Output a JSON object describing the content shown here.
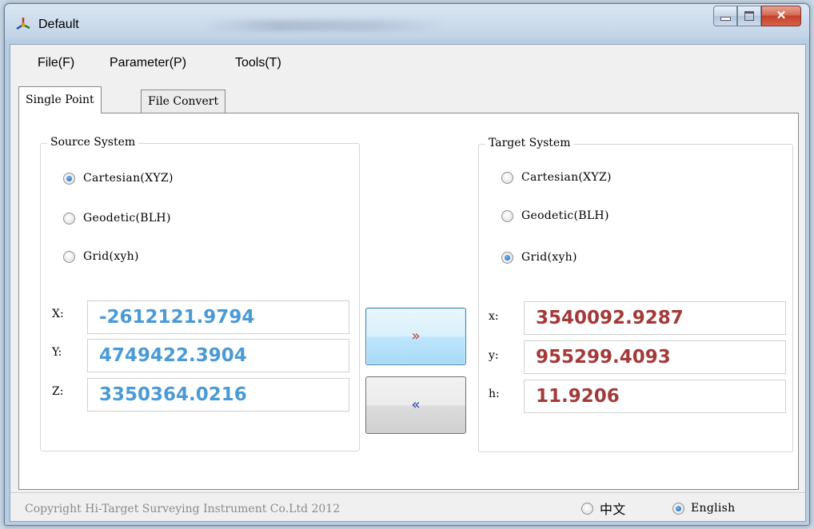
{
  "window": {
    "title": "Default"
  },
  "menu": {
    "file": "File(F)",
    "parameter": "Parameter(P)",
    "tools": "Tools(T)"
  },
  "tabs": {
    "single_point": "Single Point",
    "file_convert": "File Convert",
    "active": "Single Point"
  },
  "source": {
    "title": "Source System",
    "options": [
      "Cartesian(XYZ)",
      "Geodetic(BLH)",
      "Grid(xyh)"
    ],
    "selected": "Cartesian(XYZ)",
    "labels": [
      "X:",
      "Y:",
      "Z:"
    ],
    "values": [
      "-2612121.9794",
      "4749422.3904",
      "3350364.0216"
    ]
  },
  "target": {
    "title": "Target System",
    "options": [
      "Cartesian(XYZ)",
      "Geodetic(BLH)",
      "Grid(xyh)"
    ],
    "selected": "Grid(xyh)",
    "labels": [
      "x:",
      "y:",
      "h:"
    ],
    "values": [
      "3540092.9287",
      "955299.4093",
      "11.9206"
    ]
  },
  "buttons": {
    "forward": "»",
    "backward": "«"
  },
  "footer": {
    "copyright": "Copyright Hi-Target Surveying Instrument Co.Ltd 2012",
    "languages": [
      "中文",
      "English"
    ],
    "selected_language": "English"
  },
  "colors": {
    "source_value": "#4a9ad6",
    "target_value": "#a33a3a",
    "forward_arrow": "#c0392b",
    "backward_arrow": "#1f3fb0"
  },
  "icons": {
    "app": "cartesian-axes-icon",
    "minimize": "minimize-icon",
    "maximize": "maximize-icon",
    "close": "close-icon"
  }
}
